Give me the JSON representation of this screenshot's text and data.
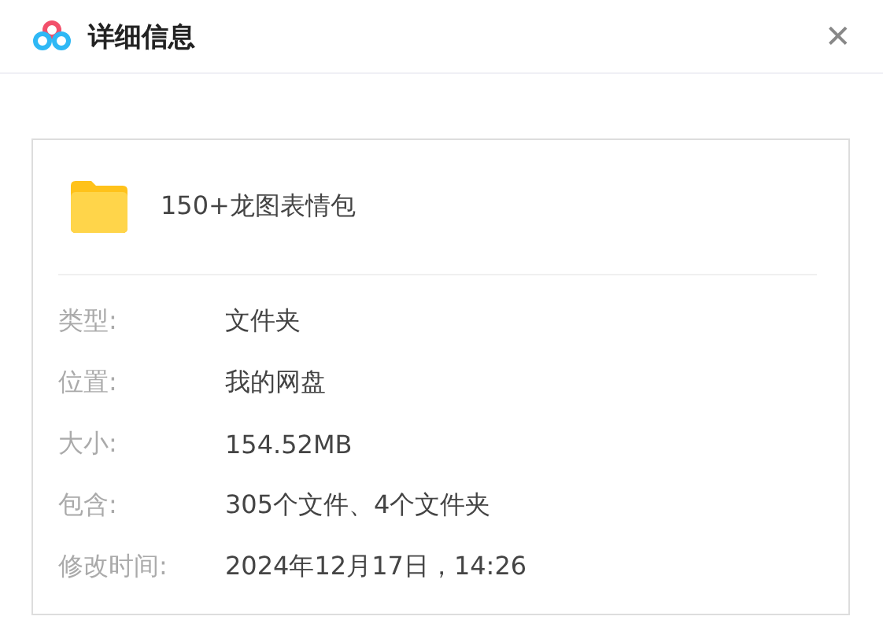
{
  "window": {
    "title": "详细信息",
    "close": "✕"
  },
  "item": {
    "name": "150+龙图表情包"
  },
  "details": [
    {
      "label": "类型:",
      "value": "文件夹"
    },
    {
      "label": "位置:",
      "value": "我的网盘"
    },
    {
      "label": "大小:",
      "value": "154.52MB"
    },
    {
      "label": "包含:",
      "value": "305个文件、4个文件夹"
    },
    {
      "label": "修改时间:",
      "value": "2024年12月17日，14:26"
    }
  ]
}
